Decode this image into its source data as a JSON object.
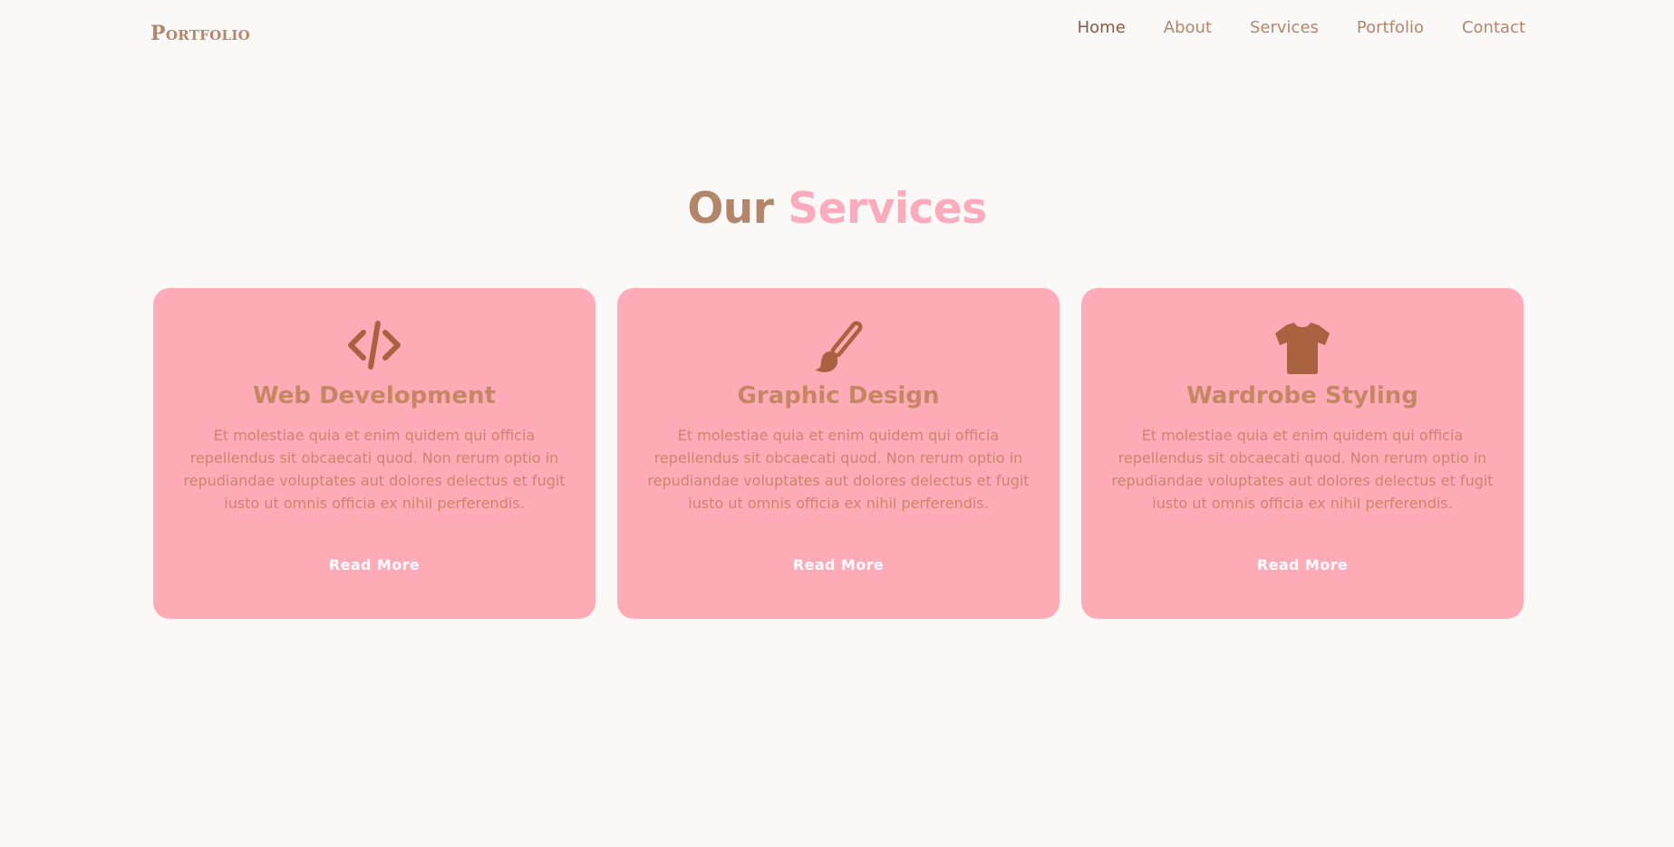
{
  "header": {
    "logo": "Portfolio",
    "nav": [
      {
        "label": "Home"
      },
      {
        "label": "About"
      },
      {
        "label": "Services"
      },
      {
        "label": "Portfolio"
      },
      {
        "label": "Contact"
      }
    ]
  },
  "services": {
    "title_part1": "Our",
    "title_part2": "Services",
    "cards": [
      {
        "icon": "code-icon",
        "title": "Web Development",
        "description": "Et molestiae quia et enim quidem qui officia repellendus sit obcaecati quod. Non rerum optio in repudiandae voluptates aut dolores delectus et fugit iusto ut omnis officia ex nihil perferendis.",
        "button": "Read More"
      },
      {
        "icon": "paint-brush-icon",
        "title": "Graphic Design",
        "description": "Et molestiae quia et enim quidem qui officia repellendus sit obcaecati quod. Non rerum optio in repudiandae voluptates aut dolores delectus et fugit iusto ut omnis officia ex nihil perferendis.",
        "button": "Read More"
      },
      {
        "icon": "tshirt-icon",
        "title": "Wardrobe Styling",
        "description": "Et molestiae quia et enim quidem qui officia repellendus sit obcaecati quod. Non rerum optio in repudiandae voluptates aut dolores delectus et fugit iusto ut omnis officia ex nihil perferendis.",
        "button": "Read More"
      }
    ]
  },
  "colors": {
    "background": "#fbf8f8",
    "brand_brown": "#b3866a",
    "accent_pink": "#fbabbb",
    "card_bg": "#ffaab7",
    "icon_brown": "#a8623f"
  }
}
